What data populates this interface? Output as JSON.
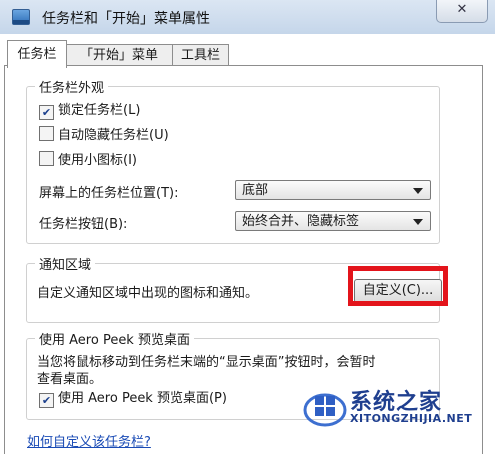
{
  "window": {
    "title": "任务栏和「开始」菜单属性",
    "close_label": "✕"
  },
  "tabs": [
    {
      "label": "任务栏",
      "active": true
    },
    {
      "label": "「开始」菜单",
      "active": false
    },
    {
      "label": "工具栏",
      "active": false
    }
  ],
  "appearance": {
    "title": "任务栏外观",
    "lock_taskbar": {
      "label": "锁定任务栏(L)",
      "checked": true
    },
    "auto_hide": {
      "label": "自动隐藏任务栏(U)",
      "checked": false
    },
    "small_icons": {
      "label": "使用小图标(I)",
      "checked": false
    },
    "location_label": "屏幕上的任务栏位置(T):",
    "location_value": "底部",
    "buttons_label": "任务栏按钮(B):",
    "buttons_value": "始终合并、隐藏标签"
  },
  "notification": {
    "title": "通知区域",
    "description": "自定义通知区域中出现的图标和通知。",
    "customize_button": "自定义(C)...",
    "highlight_color": "#e3141b"
  },
  "aero_peek": {
    "title": "使用 Aero Peek 预览桌面",
    "description_line1": "当您将鼠标移动到任务栏末端的“显示桌面”按钮时，会暂时",
    "description_line2": "查看桌面。",
    "checkbox": {
      "label": "使用 Aero Peek 预览桌面(P)",
      "checked": true
    }
  },
  "help_link": "如何自定义该任务栏?",
  "watermark": {
    "name": "系统之家",
    "url": "XITONGZHIJIA.NET"
  }
}
